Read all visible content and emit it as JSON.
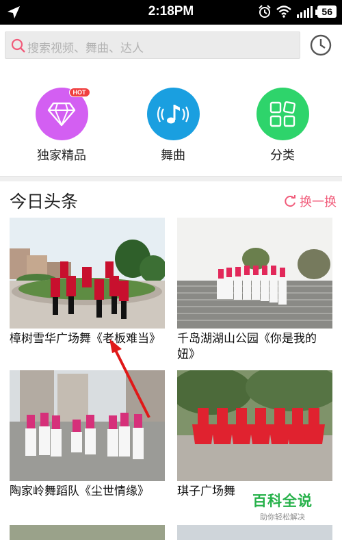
{
  "status_bar": {
    "time": "2:18PM",
    "battery": "56"
  },
  "search": {
    "placeholder": "搜索视频、舞曲、达人"
  },
  "categories": [
    {
      "label": "独家精品",
      "icon": "diamond-icon",
      "color": "#d35ff2",
      "badge": "HOT"
    },
    {
      "label": "舞曲",
      "icon": "music-note-icon",
      "color": "#1a9fe0"
    },
    {
      "label": "分类",
      "icon": "grid-icon",
      "color": "#2ed46b"
    }
  ],
  "section": {
    "title": "今日头条",
    "refresh_label": "换一换"
  },
  "videos": [
    {
      "title": "樟树雪华广场舞《老板难当》"
    },
    {
      "title": "千岛湖湖山公园《你是我的妞》"
    },
    {
      "title": "陶家岭舞蹈队《尘世情缘》"
    },
    {
      "title": "琪子广场舞"
    }
  ],
  "watermark": {
    "main": "百科全说",
    "sub": "助你轻松解决"
  },
  "colors": {
    "accent": "#f15b7a",
    "status_bg": "#000000",
    "annotation_arrow": "#e01818"
  }
}
